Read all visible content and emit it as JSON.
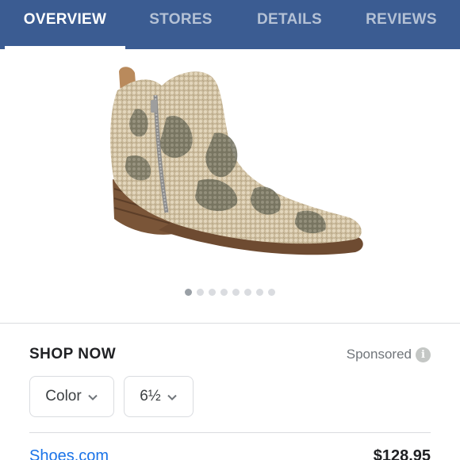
{
  "tabs": [
    {
      "label": "OVERVIEW",
      "active": true
    },
    {
      "label": "STORES",
      "active": false
    },
    {
      "label": "DETAILS",
      "active": false
    },
    {
      "label": "REVIEWS",
      "active": false
    }
  ],
  "carousel": {
    "count": 8,
    "active_index": 0
  },
  "shop": {
    "heading": "SHOP NOW",
    "sponsored_label": "Sponsored",
    "info_icon": "i"
  },
  "filters": {
    "color_label": "Color",
    "size_label": "6½"
  },
  "offer": {
    "store": "Shoes.com",
    "price": "$128.95"
  },
  "colors": {
    "tab_bar": "#3b5c92",
    "link": "#1a73e8"
  }
}
